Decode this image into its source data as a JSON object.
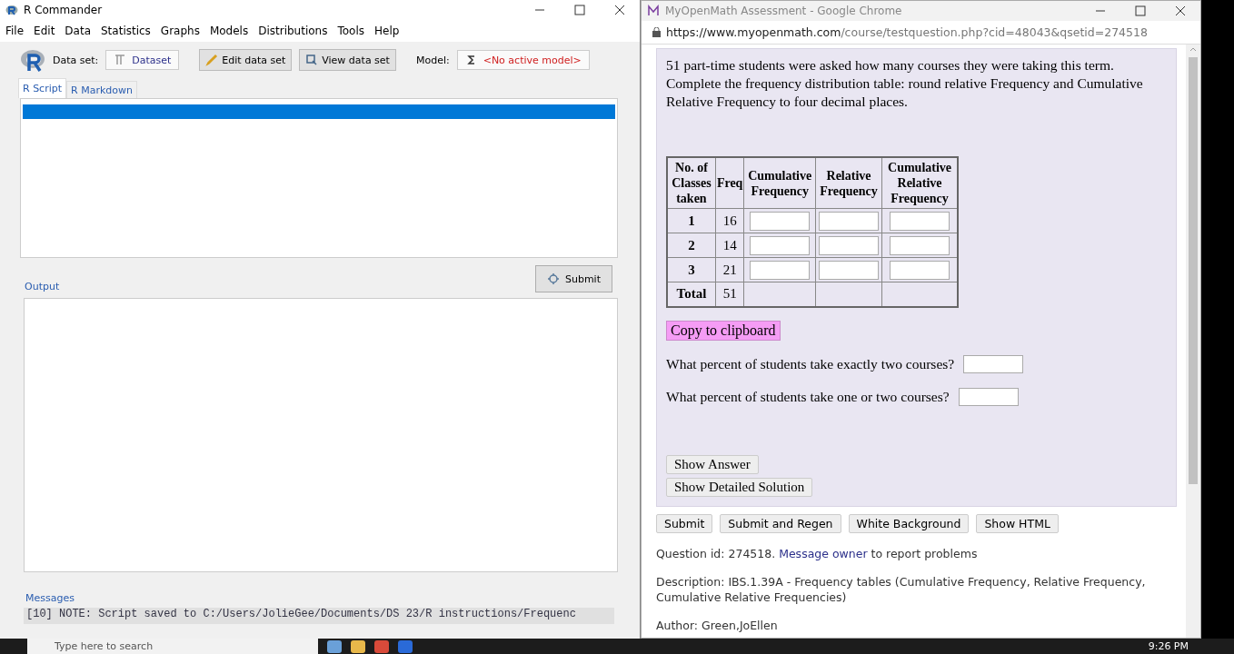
{
  "rcmdr": {
    "title": "R Commander",
    "menu": [
      "File",
      "Edit",
      "Data",
      "Statistics",
      "Graphs",
      "Models",
      "Distributions",
      "Tools",
      "Help"
    ],
    "dataset_label": "Data set:",
    "dataset": "Dataset",
    "edit_button": "Edit data set",
    "view_button": "View data set",
    "model_label": "Model:",
    "model": "<No active model>",
    "tabs": [
      {
        "label": "R Script",
        "selected": true
      },
      {
        "label": "R Markdown",
        "selected": false
      }
    ],
    "submit": "Submit",
    "output_label": "Output",
    "messages_label": "Messages",
    "message": "[10] NOTE: Script saved to C:/Users/JolieGee/Documents/DS 23/R instructions/Frequenc"
  },
  "browser": {
    "title": "MyOpenMath Assessment - Google Chrome",
    "url_host": "https://www.myopenmath.com",
    "url_path": "/course/testquestion.php?cid=48043&qsetid=274518",
    "question": "51 part-time students were asked how many courses they were taking this term.  Complete the frequency distribution table: round relative Frequency and Cumulative Relative Frequency to four decimal places.",
    "table": {
      "columns": [
        "No. of Classes taken",
        "Freq",
        "Cumulative Frequency",
        "Relative Frequency",
        "Cumulative Relative Frequency"
      ],
      "rows": [
        {
          "label": "1",
          "freq": "16"
        },
        {
          "label": "2",
          "freq": "14"
        },
        {
          "label": "3",
          "freq": "21"
        }
      ],
      "total": {
        "label": "Total",
        "freq": "51"
      }
    },
    "copy_button": "Copy to clipboard",
    "prompts": [
      "What percent of students take exactly two courses?",
      "What percent of students take one or two courses?"
    ],
    "show_buttons": [
      "Show Answer",
      "Show Detailed Solution"
    ],
    "actions": [
      "Submit",
      "Submit and Regen",
      "White Background",
      "Show HTML"
    ],
    "qid_before": "Question id: 274518. ",
    "qid_link": "Message owner",
    "qid_after": " to report problems",
    "description": "Description: IBS.1.39A - Frequency tables (Cumulative Frequency, Relative Frequency, Cumulative Relative Frequencies)",
    "author": "Author: Green,JoEllen"
  },
  "taskbar": {
    "search_placeholder": "Type here to search",
    "time": "9:26 PM"
  }
}
